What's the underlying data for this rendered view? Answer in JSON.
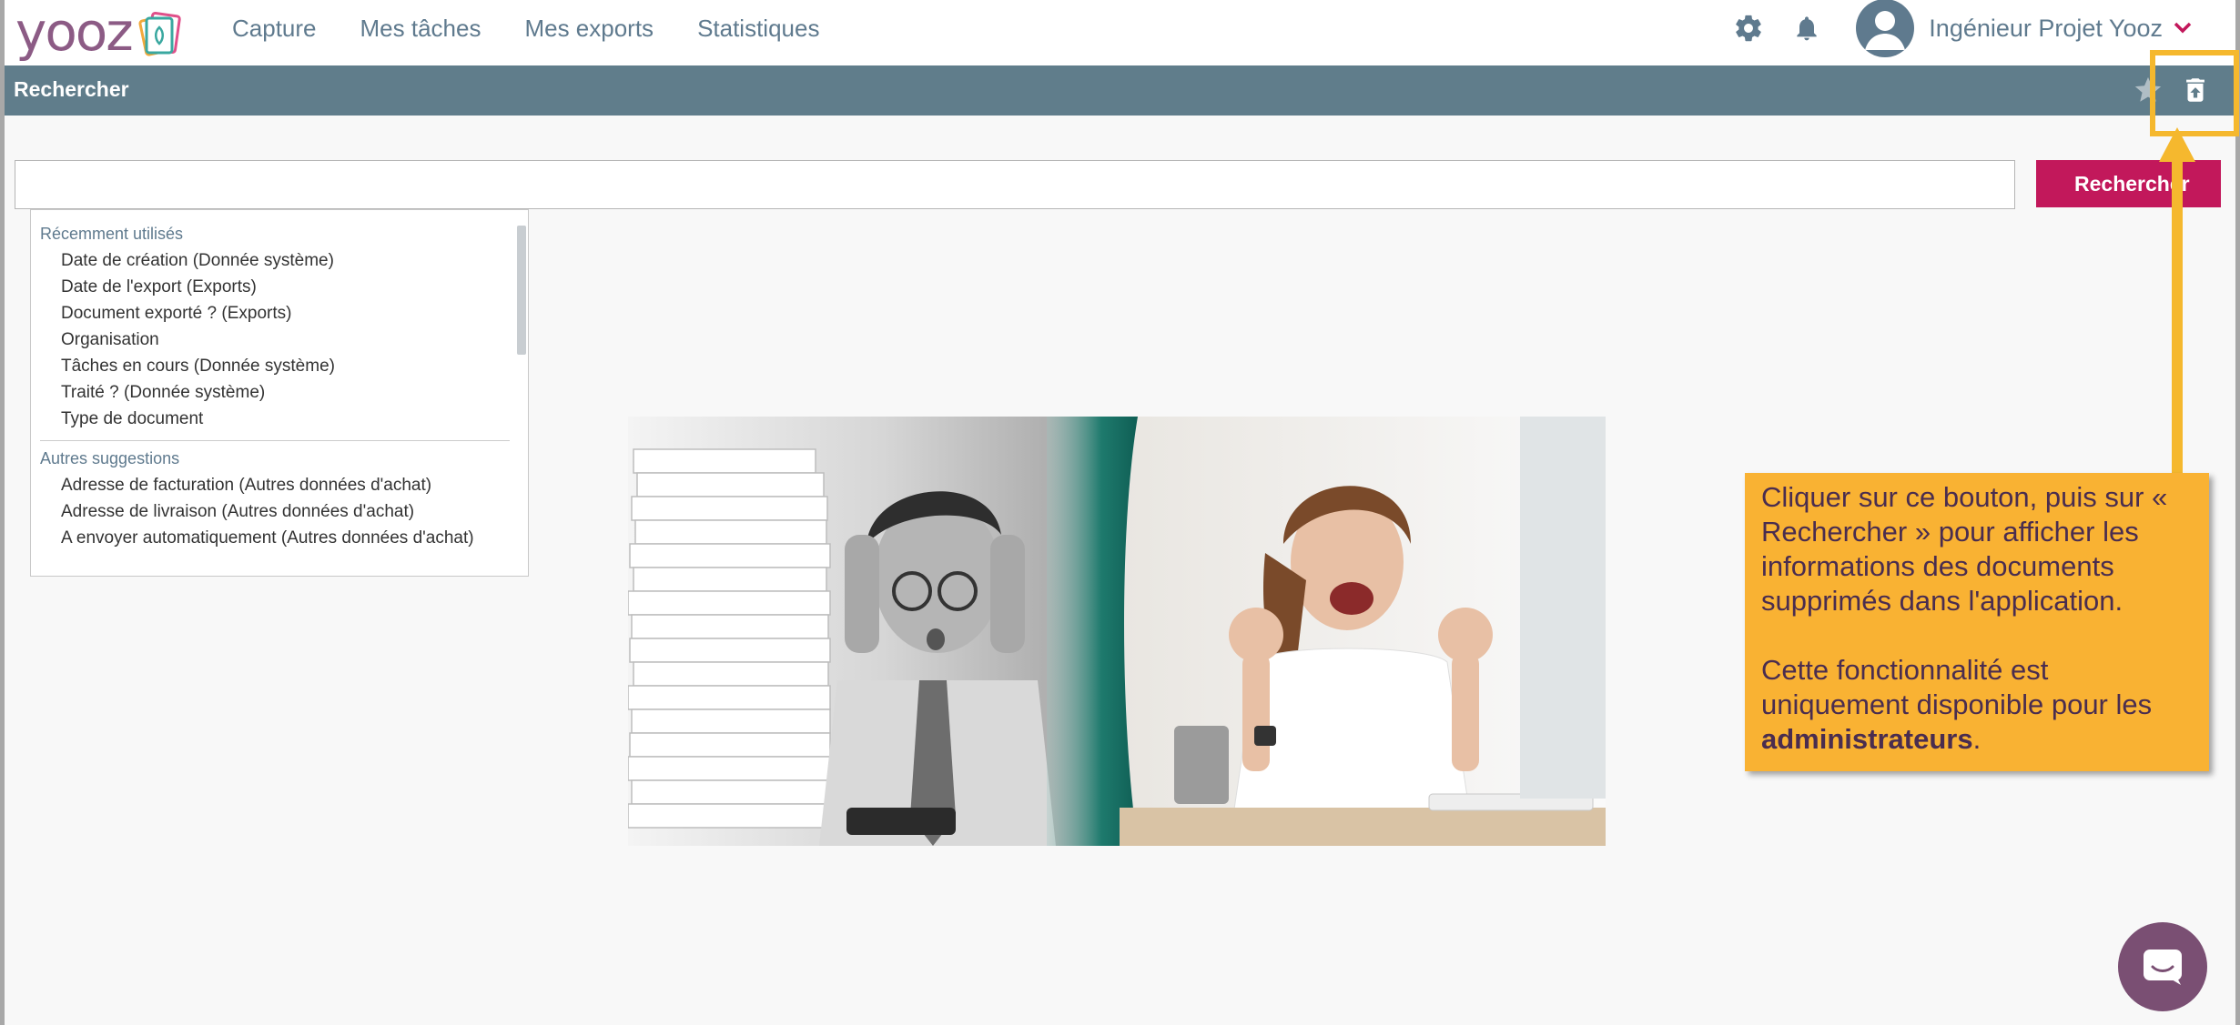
{
  "app": {
    "logo_text": "yooz",
    "nav": [
      "Capture",
      "Mes tâches",
      "Mes exports",
      "Statistiques"
    ],
    "user_name": "Ingénieur Projet Yooz"
  },
  "band": {
    "title": "Rechercher"
  },
  "search": {
    "value": "",
    "button_label": "Rechercher"
  },
  "dropdown": {
    "recent_title": "Récemment utilisés",
    "recent_items": [
      "Date de création (Donnée système)",
      "Date de l'export (Exports)",
      "Document exporté ? (Exports)",
      "Organisation",
      "Tâches en cours (Donnée système)",
      "Traité ? (Donnée système)",
      "Type de document"
    ],
    "other_title": "Autres suggestions",
    "other_items": [
      "Adresse de facturation (Autres données d'achat)",
      "Adresse de livraison (Autres données d'achat)",
      "A envoyer automatiquement (Autres données d'achat)"
    ]
  },
  "callout": {
    "para1": "Cliquer sur ce bouton, puis sur « Rechercher » pour afficher les informations des documents supprimés dans l'application.",
    "para2_prefix": "Cette fonctionnalité est uniquement disponible pour les ",
    "para2_bold": "administrateurs",
    "para2_suffix": "."
  },
  "colors": {
    "brand": "#8c5b85",
    "nav_text": "#5f7a8e",
    "band": "#607d8b",
    "search_button": "#c2185b",
    "callout": "#f9b233",
    "chat": "#7a4f73"
  },
  "icons": [
    "gear-icon",
    "bell-icon",
    "user-icon",
    "chevron-down-icon",
    "star-icon",
    "trash-restore-icon",
    "chat-icon"
  ]
}
